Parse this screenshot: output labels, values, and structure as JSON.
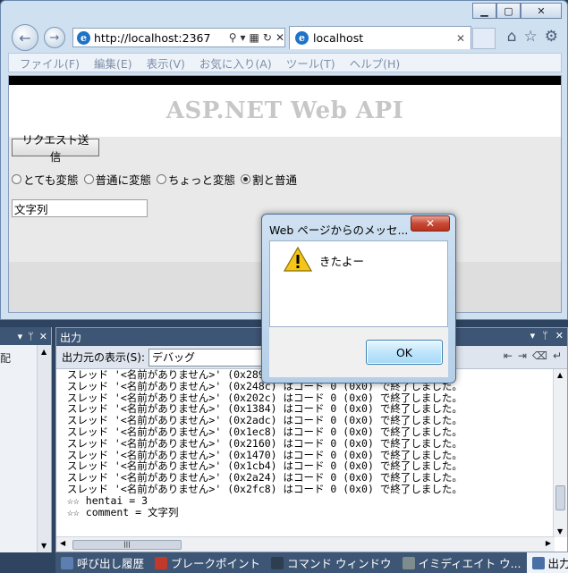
{
  "browser": {
    "address_url": "http://localhost:2367",
    "tab_title": "localhost",
    "menu": [
      "ファイル(F)",
      "編集(E)",
      "表示(V)",
      "お気に入り(A)",
      "ツール(T)",
      "ヘルプ(H)"
    ],
    "page": {
      "heading": "ASP.NET Web API",
      "request_button": "リクエスト送信",
      "radios": [
        {
          "label": "とても変態",
          "selected": false
        },
        {
          "label": "普通に変態",
          "selected": false
        },
        {
          "label": "ちょっと変態",
          "selected": false
        },
        {
          "label": "割と普通",
          "selected": true
        }
      ],
      "text_value": "文字列"
    }
  },
  "dialog": {
    "title": "Web ページからのメッセ...",
    "message": "きたよー",
    "ok_label": "OK",
    "icon": "warning-icon"
  },
  "vs": {
    "left_panel_cut_text": "配",
    "output": {
      "title": "出力",
      "source_label": "出力元の表示(S):",
      "source_value": "デバッグ",
      "lines": [
        "スレッド '<名前がありません>' (0x289",
        "スレッド '<名前がありません>' (0x248c) はコード 0 (0x0) で終了しました。",
        "スレッド '<名前がありません>' (0x202c) はコード 0 (0x0) で終了しました。",
        "スレッド '<名前がありません>' (0x1384) はコード 0 (0x0) で終了しました。",
        "スレッド '<名前がありません>' (0x2adc) はコード 0 (0x0) で終了しました。",
        "スレッド '<名前がありません>' (0x1ec8) はコード 0 (0x0) で終了しました。",
        "スレッド '<名前がありません>' (0x2160) はコード 0 (0x0) で終了しました。",
        "スレッド '<名前がありません>' (0x1470) はコード 0 (0x0) で終了しました。",
        "スレッド '<名前がありません>' (0x1cb4) はコード 0 (0x0) で終了しました。",
        "スレッド '<名前がありません>' (0x2a24) はコード 0 (0x0) で終了しました。",
        "スレッド '<名前がありません>' (0x2fc8) はコード 0 (0x0) で終了しました。",
        "☆☆ hentai = 3",
        "☆☆ comment = 文字列"
      ]
    },
    "taskbar": [
      {
        "label": "呼び出し履歴",
        "icon": "call-stack-icon",
        "color": "#5b7fb0",
        "active": false
      },
      {
        "label": "ブレークポイント",
        "icon": "breakpoint-icon",
        "color": "#c0392b",
        "active": false
      },
      {
        "label": "コマンド ウィンドウ",
        "icon": "command-window-icon",
        "color": "#2c3e50",
        "active": false
      },
      {
        "label": "イミディエイト ウ...",
        "icon": "immediate-window-icon",
        "color": "#7f8c8d",
        "active": false
      },
      {
        "label": "出力",
        "icon": "output-icon",
        "color": "#4a6fa5",
        "active": true
      }
    ]
  }
}
